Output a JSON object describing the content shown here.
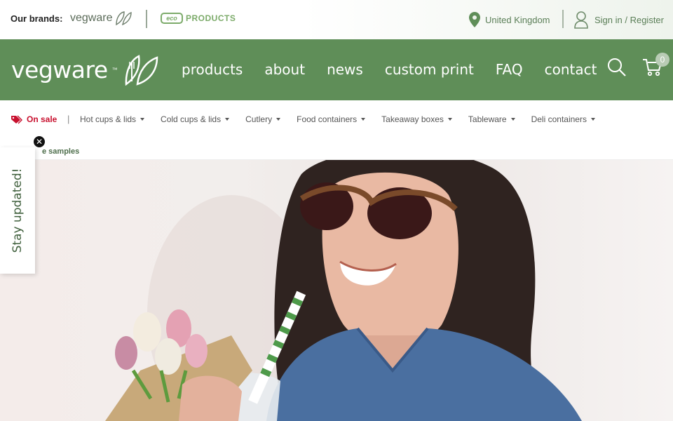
{
  "topbar": {
    "brands_label": "Our brands:",
    "brand1": "vegware",
    "brand2_badge": "eco",
    "brand2": "PRODUCTS",
    "country": "United Kingdom",
    "signin": "Sign in / Register"
  },
  "nav": {
    "logo": "vegware",
    "tm": "™",
    "links": [
      "products",
      "about",
      "news",
      "custom print",
      "FAQ",
      "contact"
    ],
    "cart_count": "0"
  },
  "categories": {
    "on_sale": "On sale",
    "pipe": "|",
    "items": [
      "Hot cups & lids",
      "Cold cups & lids",
      "Cutlery",
      "Food containers",
      "Takeaway boxes",
      "Tableware",
      "Deli containers"
    ],
    "samples": "e samples"
  },
  "popup": {
    "stay_updated": "Stay updated!",
    "close": "✕"
  },
  "colors": {
    "brand_green": "#5f8e58",
    "sale_red": "#c8102e"
  }
}
